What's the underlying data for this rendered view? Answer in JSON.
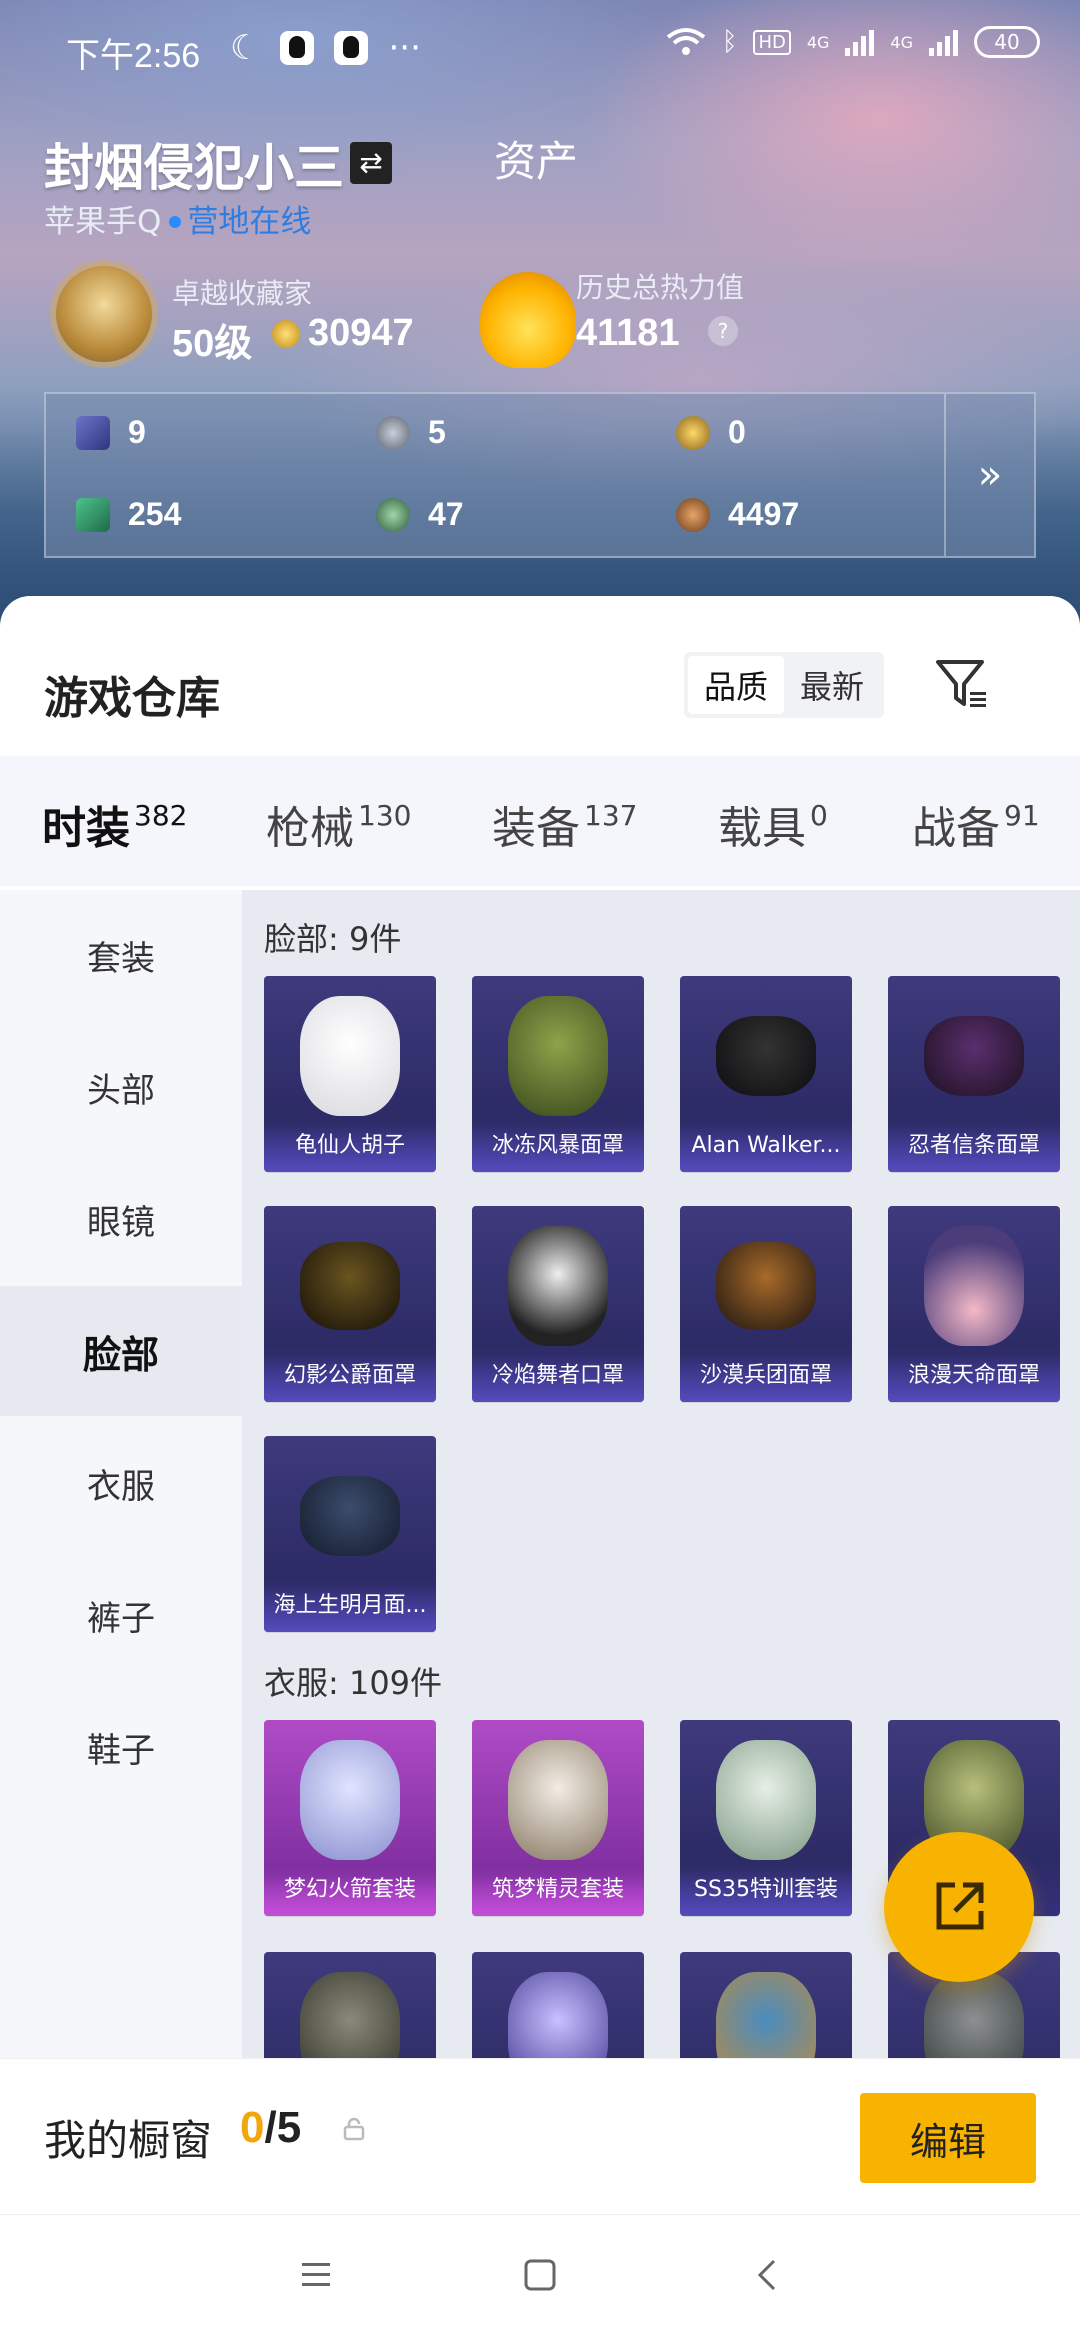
{
  "status_bar": {
    "time": "下午2:56",
    "more": "···",
    "hd": "HD",
    "net1": "4G",
    "net2": "4G",
    "battery": "40"
  },
  "profile": {
    "username": "封烟侵犯小三",
    "swap_icon": "⇄",
    "assets_link": "资产",
    "platform": "苹果手Q",
    "online_status": "营地在线",
    "collector_title": "卓越收藏家",
    "level": "50级",
    "coins": "30947",
    "heat_label": "历史总热力值",
    "heat_value": "41181",
    "help": "?"
  },
  "stats": [
    {
      "icon": "card-icon",
      "value": "9"
    },
    {
      "icon": "silver-medal-icon",
      "value": "5"
    },
    {
      "icon": "gold-medal-icon",
      "value": "0"
    },
    {
      "icon": "green-card-icon",
      "value": "254"
    },
    {
      "icon": "green-coin-icon",
      "value": "47"
    },
    {
      "icon": "bronze-coin-icon",
      "value": "4497"
    }
  ],
  "stats_more": "»",
  "warehouse": {
    "title": "游戏仓库",
    "sort_options": [
      "品质",
      "最新"
    ],
    "active_sort": "品质"
  },
  "tabs": [
    {
      "label": "时装",
      "count": "382"
    },
    {
      "label": "枪械",
      "count": "130"
    },
    {
      "label": "装备",
      "count": "137"
    },
    {
      "label": "载具",
      "count": "0"
    },
    {
      "label": "战备",
      "count": "91"
    }
  ],
  "sidebar": [
    "套装",
    "头部",
    "眼镜",
    "脸部",
    "衣服",
    "裤子",
    "鞋子"
  ],
  "active_sidebar": "脸部",
  "sections": [
    {
      "title": "脸部: 9件",
      "items": [
        "龟仙人胡子",
        "冰冻风暴面罩",
        "Alan Walker...",
        "忍者信条面罩",
        "幻影公爵面罩",
        "冷焰舞者口罩",
        "沙漠兵团面罩",
        "浪漫天命面罩",
        "海上生明月面..."
      ]
    },
    {
      "title": "衣服: 109件",
      "items": [
        "梦幻火箭套装",
        "筑梦精灵套装",
        "SS35特训套装"
      ]
    }
  ],
  "showcase": {
    "label": "我的橱窗",
    "current": "0",
    "total": "/5",
    "edit": "编辑"
  },
  "colors": {
    "accent": "#f7b300",
    "online": "#2f7de0",
    "card": "#34307a",
    "card_purple": "#9a3bbb"
  }
}
